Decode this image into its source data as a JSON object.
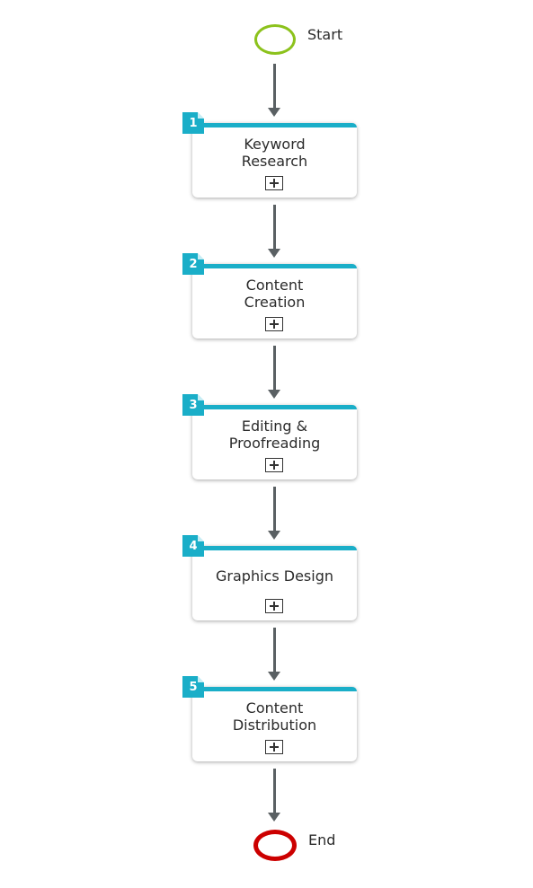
{
  "start": {
    "label": "Start",
    "color": "#8cc21c"
  },
  "end": {
    "label": "End",
    "color": "#cc0000"
  },
  "accent_color": "#1aaec8",
  "tasks": [
    {
      "number": "1",
      "title_line1": "Keyword",
      "title_line2": "Research",
      "icon": "expand-plus-icon"
    },
    {
      "number": "2",
      "title_line1": "Content",
      "title_line2": "Creation",
      "icon": "expand-plus-icon"
    },
    {
      "number": "3",
      "title_line1": "Editing &",
      "title_line2": "Proofreading",
      "icon": "expand-plus-icon"
    },
    {
      "number": "4",
      "title_line1": "Graphics Design",
      "title_line2": "",
      "icon": "expand-plus-icon"
    },
    {
      "number": "5",
      "title_line1": "Content",
      "title_line2": "Distribution",
      "icon": "expand-plus-icon"
    }
  ]
}
